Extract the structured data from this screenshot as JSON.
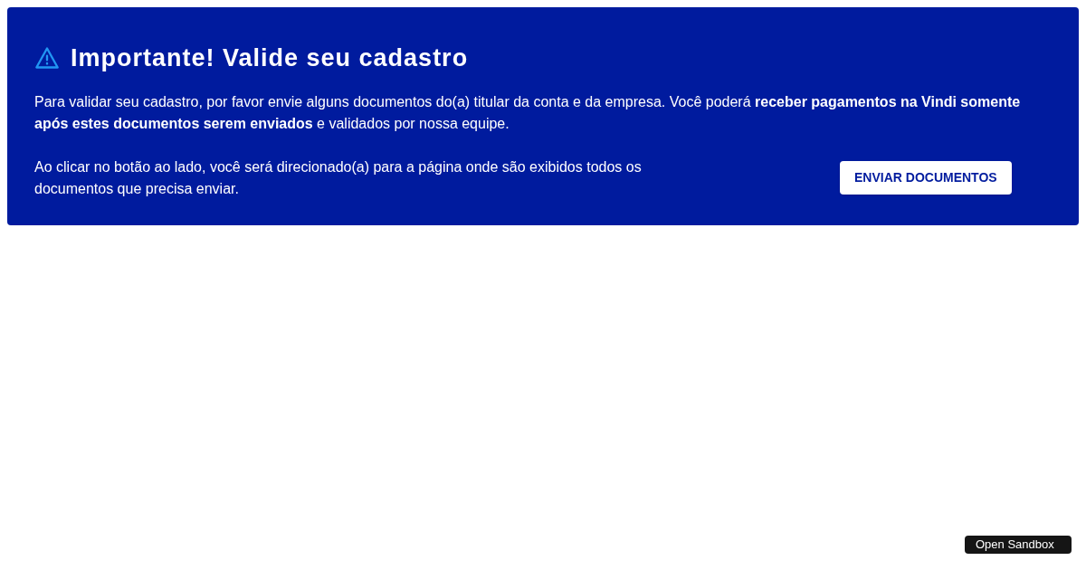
{
  "alert": {
    "title": "Importante! Valide seu cadastro",
    "message": "Para validar seu cadastro, por favor envie alguns documentos do(a) titular da conta e da empresa. Você poderá **receber pagamentos na Vindi somente após estes documentos serem enviados** e validados por nossa equipe.",
    "instruction": "Ao clicar no botão ao lado, você será direcionado(a) para a página onde são exibidos todos os documentos que precisa enviar.",
    "button": "ENVIAR DOCUMENTOS"
  },
  "sandbox_button": "Open Sandbox"
}
